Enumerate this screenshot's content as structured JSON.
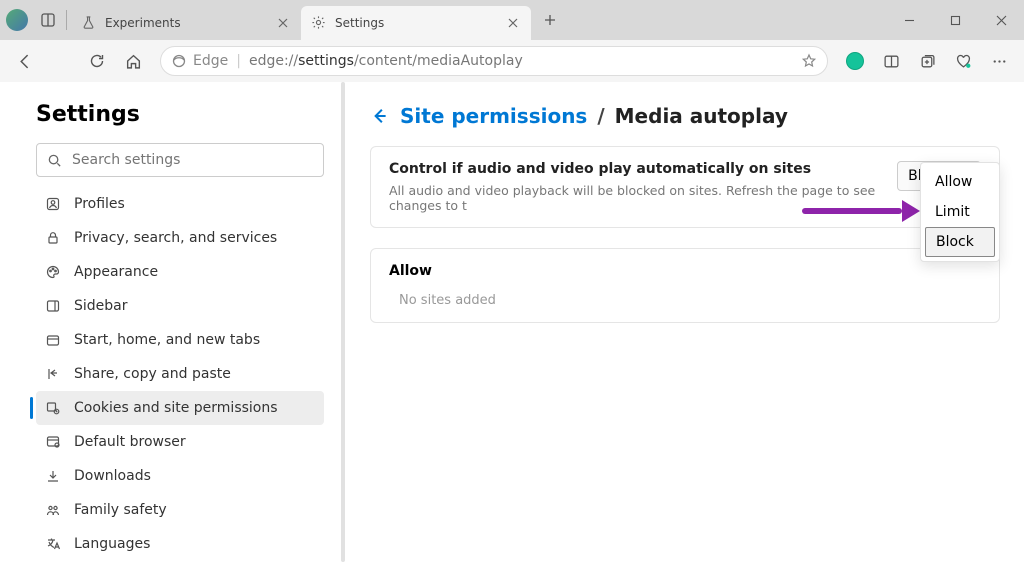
{
  "tabs": [
    {
      "icon": "flask-icon",
      "label": "Experiments"
    },
    {
      "icon": "gear-icon",
      "label": "Settings"
    }
  ],
  "address": {
    "prefix": "Edge",
    "url_plain1": "edge://",
    "url_bold": "settings",
    "url_plain2": "/content/mediaAutoplay"
  },
  "settings_title": "Settings",
  "search_placeholder": "Search settings",
  "nav": [
    {
      "icon": "profile-icon",
      "label": "Profiles"
    },
    {
      "icon": "lock-icon",
      "label": "Privacy, search, and services"
    },
    {
      "icon": "appearance-icon",
      "label": "Appearance"
    },
    {
      "icon": "sidebar-icon",
      "label": "Sidebar"
    },
    {
      "icon": "tabs-icon",
      "label": "Start, home, and new tabs"
    },
    {
      "icon": "share-icon",
      "label": "Share, copy and paste"
    },
    {
      "icon": "cookies-icon",
      "label": "Cookies and site permissions",
      "active": true
    },
    {
      "icon": "browser-icon",
      "label": "Default browser"
    },
    {
      "icon": "download-icon",
      "label": "Downloads"
    },
    {
      "icon": "family-icon",
      "label": "Family safety"
    },
    {
      "icon": "language-icon",
      "label": "Languages"
    }
  ],
  "breadcrumb": {
    "back_icon": "arrow-left-icon",
    "link": "Site permissions",
    "sep": "/",
    "leaf": "Media autoplay"
  },
  "control_card": {
    "title": "Control if audio and video play automatically on sites",
    "description": "All audio and video playback will be blocked on sites. Refresh the page to see changes to t",
    "select_value": "Block"
  },
  "dropdown_options": [
    "Allow",
    "Limit",
    "Block"
  ],
  "dropdown_selected": "Block",
  "allow_section": {
    "title": "Allow",
    "empty": "No sites added"
  }
}
